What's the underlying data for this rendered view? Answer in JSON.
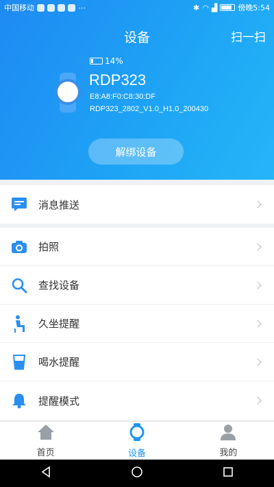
{
  "status_bar": {
    "carrier": "中国移动",
    "time": "傍晚5:54"
  },
  "header": {
    "title": "设备",
    "scan_label": "扫一扫"
  },
  "device": {
    "battery": "14%",
    "name": "RDP323",
    "mac": "E8:A8:F0:C8:30:DF",
    "firmware": "RDP323_2802_V1.0_H1.0_200430",
    "unbind_label": "解绑设备"
  },
  "menu_top": [
    {
      "label": "消息推送",
      "icon": "message-icon"
    }
  ],
  "menu_main": [
    {
      "label": "拍照",
      "icon": "camera-icon"
    },
    {
      "label": "查找设备",
      "icon": "search-icon"
    },
    {
      "label": "久坐提醒",
      "icon": "sitting-icon"
    },
    {
      "label": "喝水提醒",
      "icon": "water-cup-icon"
    },
    {
      "label": "提醒模式",
      "icon": "bell-icon"
    }
  ],
  "tabs": [
    {
      "label": "首页",
      "icon": "home-icon",
      "active": false
    },
    {
      "label": "设备",
      "icon": "watch-icon",
      "active": true
    },
    {
      "label": "我的",
      "icon": "person-icon",
      "active": false
    }
  ],
  "colors": {
    "accent": "#1e96f3",
    "icon_blue": "#2a8ff0"
  }
}
